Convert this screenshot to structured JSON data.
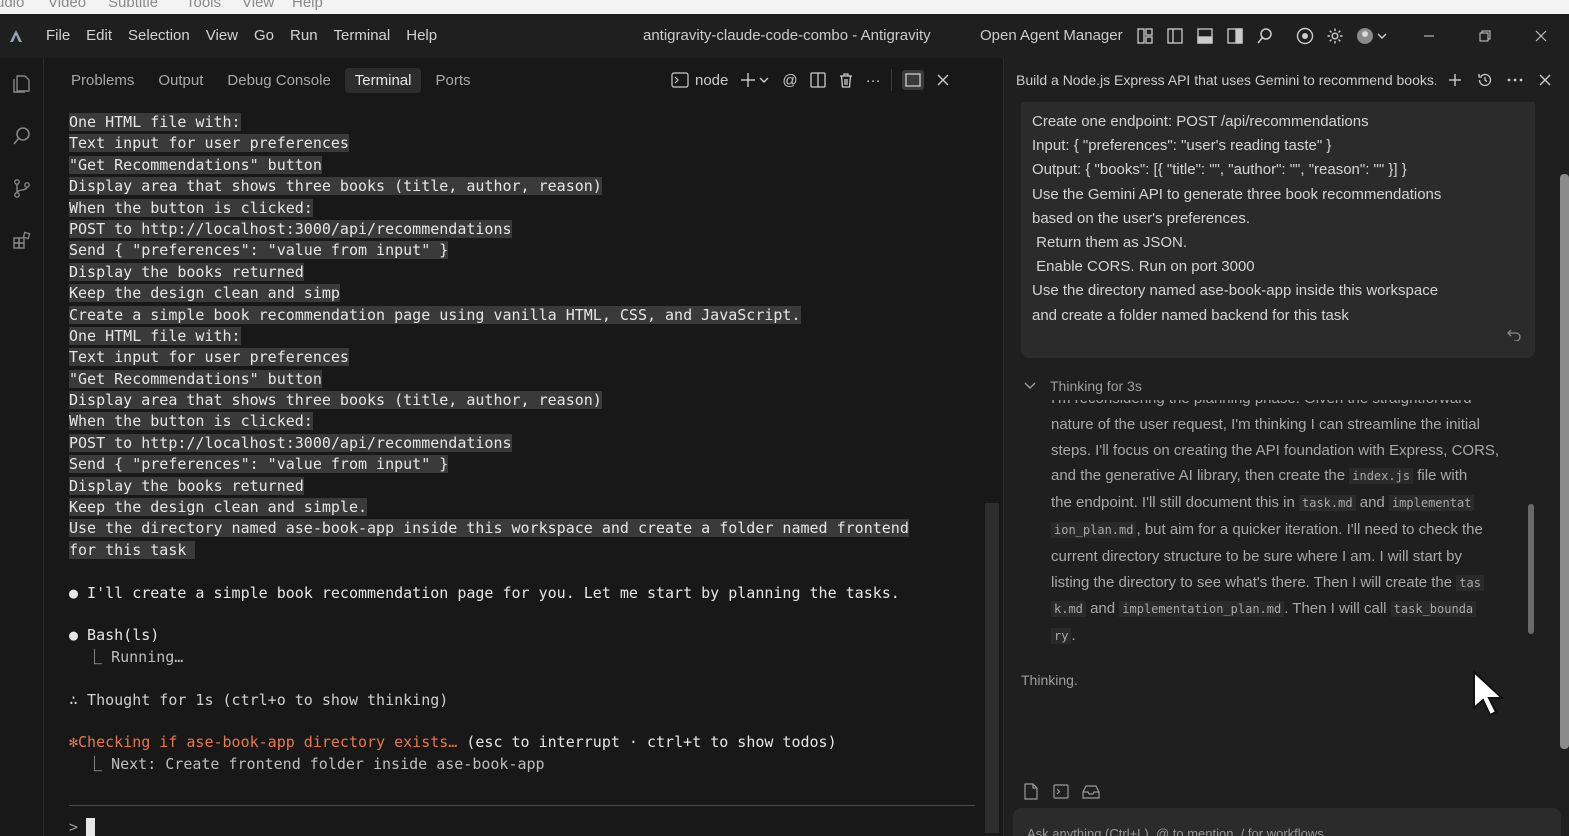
{
  "remnant_menu": [
    "udio",
    "Video",
    "Subtitle",
    "Tools",
    "View",
    "Help"
  ],
  "menu": [
    "File",
    "Edit",
    "Selection",
    "View",
    "Go",
    "Run",
    "Terminal",
    "Help"
  ],
  "window_title": "antigravity-claude-code-combo - Antigravity",
  "open_agent_manager": "Open Agent Manager",
  "panel": {
    "tabs": [
      "Problems",
      "Output",
      "Debug Console",
      "Terminal",
      "Ports"
    ],
    "active_tab": "Terminal",
    "shell_label": "node",
    "at_label": "@",
    "more_label": "···"
  },
  "terminal": {
    "block1": [
      "One HTML file with:",
      "Text input for user preferences",
      "\"Get Recommendations\" button",
      "Display area that shows three books (title, author, reason)",
      "When the button is clicked:",
      "POST to http://localhost:3000/api/recommendations",
      "Send { \"preferences\": \"value from input\" }",
      "Display the books returned",
      "Keep the design clean and simp",
      "Create a simple book recommendation page using vanilla HTML, CSS, and JavaScript.",
      "One HTML file with:",
      "Text input for user preferences",
      "\"Get Recommendations\" button",
      "Display area that shows three books (title, author, reason)",
      "When the button is clicked:",
      "POST to http://localhost:3000/api/recommendations",
      "Send { \"preferences\": \"value from input\" }",
      "Display the books returned",
      "Keep the design clean and simple.",
      "Use the directory named ase-book-app inside this workspace and create a folder named frontend",
      "for this task "
    ],
    "assistant_msg": "● I'll create a simple book recommendation page for you. Let me start by planning the tasks.",
    "bash_cmd": "● Bash(ls)",
    "bash_status": "  ⎿ Running…",
    "thought": "∴ Thought for 1s (ctrl+o to show thinking)",
    "status_active": "✻Checking if ase-book-app directory exists…",
    "status_hint": " (esc to interrupt · ctrl+t to show todos)",
    "next": "  ⎿ Next: Create frontend folder inside ase-book-app",
    "prompt_symbol": ">"
  },
  "agent": {
    "title": "Build a Node.js Express API that uses Gemini to recommend books. ...",
    "user_message": [
      "Create one endpoint: POST /api/recommendations",
      "Input: { \"preferences\": \"user's reading taste\" }",
      "Output: { \"books\": [{ \"title\": \"\", \"author\": \"\", \"reason\": \"\" }] }",
      "Use the Gemini API to generate three book recommendations",
      "based on the user's preferences.",
      " Return them as JSON.",
      " Enable CORS. Run on port 3000",
      "",
      "Use the directory named ase-book-app inside this workspace",
      "and create a folder named backend for this task"
    ],
    "thinking_header": "Thinking for 3s",
    "thinking_cut": "I'm reconsidering the planning phase. Given the straightforward",
    "thinking_lines": [
      [
        "nature of the user request, I'm thinking I can streamline the initial"
      ],
      [
        "steps. I'll focus on creating the API foundation with Express, CORS,"
      ],
      [
        "and the generative AI library, then create the ",
        {
          "code": "index.js"
        },
        " file with"
      ],
      [
        "the endpoint. I'll still document this in ",
        {
          "code": "task.md"
        },
        " and ",
        {
          "code": "implementat"
        }
      ],
      [
        {
          "code": "ion_plan.md"
        },
        ", but aim for a quicker iteration. I'll need to check the"
      ],
      [
        "current directory structure to be sure where I am. I will start by"
      ],
      [
        "listing the directory to see what's there. Then I will create the ",
        {
          "code": "tas"
        }
      ],
      [
        {
          "code": "k.md"
        },
        " and ",
        {
          "code": "implementation_plan.md"
        },
        ". Then I will call ",
        {
          "code": "task_bounda"
        }
      ],
      [
        {
          "code": "ry"
        },
        "."
      ]
    ],
    "thinking_status": "Thinking.",
    "input_placeholder": "Ask anything (Ctrl+L), @ to mention, / for workflows"
  }
}
